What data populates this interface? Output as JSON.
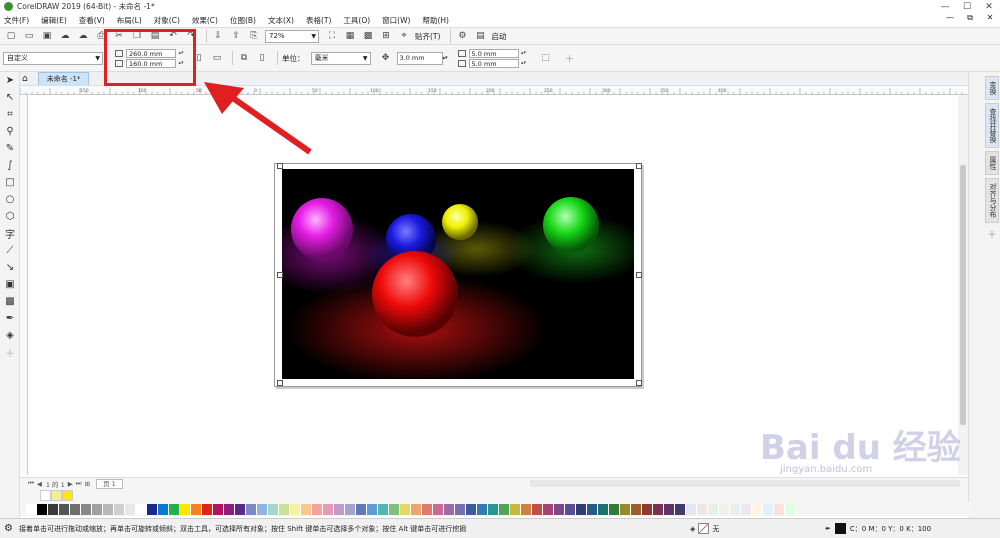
{
  "window": {
    "title": "CorelDRAW 2019 (64-Bit) - 未命名 -1*",
    "min": "—",
    "max": "☐",
    "close": "✕"
  },
  "menu": [
    "文件(F)",
    "编辑(E)",
    "查看(V)",
    "布局(L)",
    "对象(C)",
    "效果(C)",
    "位图(B)",
    "文本(X)",
    "表格(T)",
    "工具(O)",
    "窗口(W)",
    "帮助(H)"
  ],
  "menu_ctl": {
    "min": "—",
    "restore": "⧉",
    "close": "✕"
  },
  "toolbar1": {
    "zoom": "72%",
    "snap": "贴齐(T)",
    "launch": "启动"
  },
  "toolbar2": {
    "preset": "自定义",
    "width": "260.0 mm",
    "height": "160.0 mm",
    "units_label": "单位：",
    "units": "毫米",
    "nudge": "3.0 mm",
    "dup_x": "5.0 mm",
    "dup_y": "5.0 mm"
  },
  "doc_tab": "未命名 -1*",
  "ruler_ticks": [
    "150",
    "100",
    "50",
    "0",
    "50",
    "100",
    "150",
    "200",
    "250",
    "300",
    "350",
    "400"
  ],
  "page_bar": {
    "page": "1 的 1",
    "tab": "页 1"
  },
  "dockers": [
    "变换",
    "查找并替换",
    "属性",
    "对齐与分布"
  ],
  "status": {
    "message": "接着单击可进行拖动或缩放；再单击可旋转或倾斜；双击工具，可选择所有对象；按住 Shift 键单击可选择多个对象；按住 Alt 键单击可进行挖掘",
    "fill": "无",
    "cmyk": "C：0 M：0 Y：0 K：100"
  },
  "watermark": {
    "brand": "Bai du 经验",
    "url": "jingyan.baidu.com"
  },
  "colors": {
    "highlight": "#e02020",
    "accent": "#3a8f2f"
  },
  "palette_top": [
    "#ffffff",
    "#f5f08a",
    "#ffe600"
  ],
  "palette": [
    "#ffffff",
    "#000000",
    "#3a3a3a",
    "#555555",
    "#6e6e6e",
    "#888888",
    "#a0a0a0",
    "#b8b8b8",
    "#d0d0d0",
    "#e8e8e8",
    "#ffffff",
    "#1b2a8a",
    "#0a78c8",
    "#21b04b",
    "#ffe600",
    "#f5821f",
    "#e2231a",
    "#b3125f",
    "#8b1e7a",
    "#5a2b86",
    "#7c89c2",
    "#8fb6e3",
    "#a5d6c6",
    "#c9e29b",
    "#f7f1a5",
    "#f8c88e",
    "#f4a39b",
    "#e79ab8",
    "#c39bc9",
    "#a8a2d1",
    "#5f7ab8",
    "#5e9bd4",
    "#52b6ae",
    "#7fc17a",
    "#e4d76a",
    "#e9a66e",
    "#de7a6f",
    "#c96a93",
    "#9a6aa9",
    "#7670ae",
    "#3d5a9a",
    "#3679b5",
    "#2a978f",
    "#4ea457",
    "#c8b93e",
    "#cd8142",
    "#c14f43",
    "#a54471",
    "#7b4889",
    "#5a4f8f",
    "#2f3f6f",
    "#255a89",
    "#1f726c",
    "#357a3d",
    "#978a2a",
    "#9b5f2f",
    "#8f3a31",
    "#7a3253",
    "#5b3566",
    "#433b6a",
    "#e6e6f0",
    "#f0e6e6",
    "#e6f0e6",
    "#f0f0e6",
    "#e6f0f0",
    "#f0e6f0",
    "#fff5e0",
    "#e0f0ff",
    "#ffe0e0",
    "#e0ffe0"
  ]
}
